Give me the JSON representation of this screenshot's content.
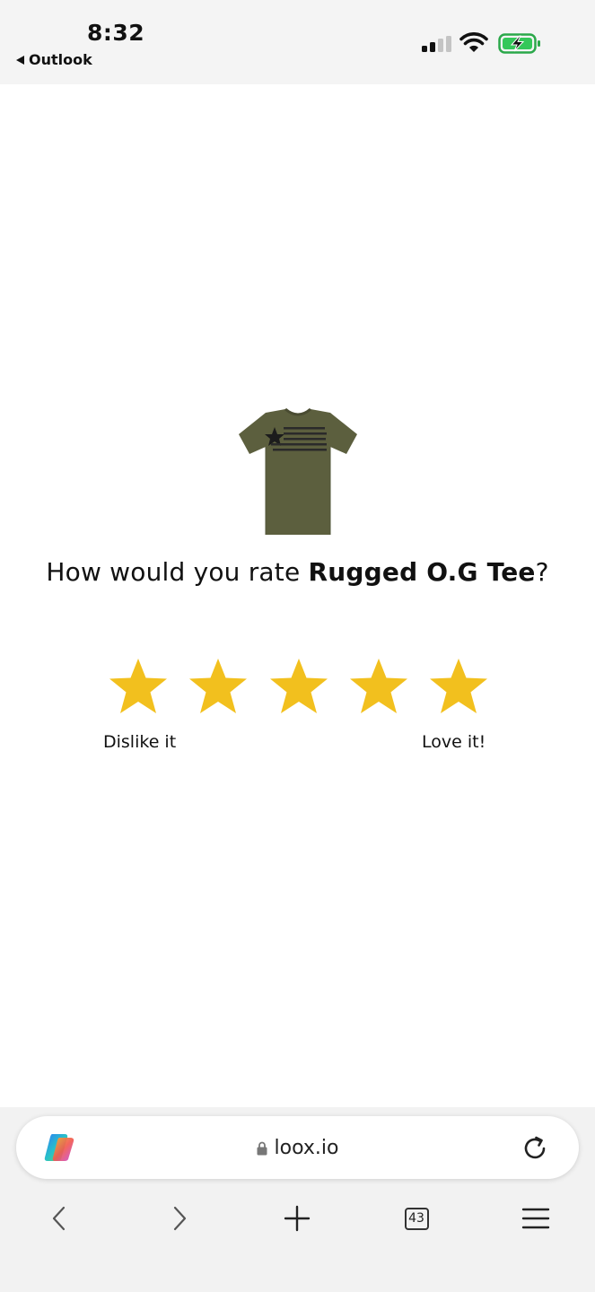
{
  "status_bar": {
    "time": "8:32",
    "back_app": "Outlook",
    "icons": [
      "signal-icon",
      "wifi-icon",
      "battery-charging-icon"
    ]
  },
  "review": {
    "question_prefix": "How would you rate ",
    "product_name": "Rugged O.G Tee",
    "question_suffix": "?",
    "stars": [
      1,
      2,
      3,
      4,
      5
    ],
    "star_color": "#F2C01E",
    "label_low": "Dislike it",
    "label_high": "Love it!",
    "product_image_color": "#5C5F3E"
  },
  "browser": {
    "url": "loox.io",
    "tabs_count": "43",
    "toolbar_icons": [
      "back-icon",
      "forward-icon",
      "new-tab-icon",
      "tabs-icon",
      "menu-icon"
    ]
  }
}
